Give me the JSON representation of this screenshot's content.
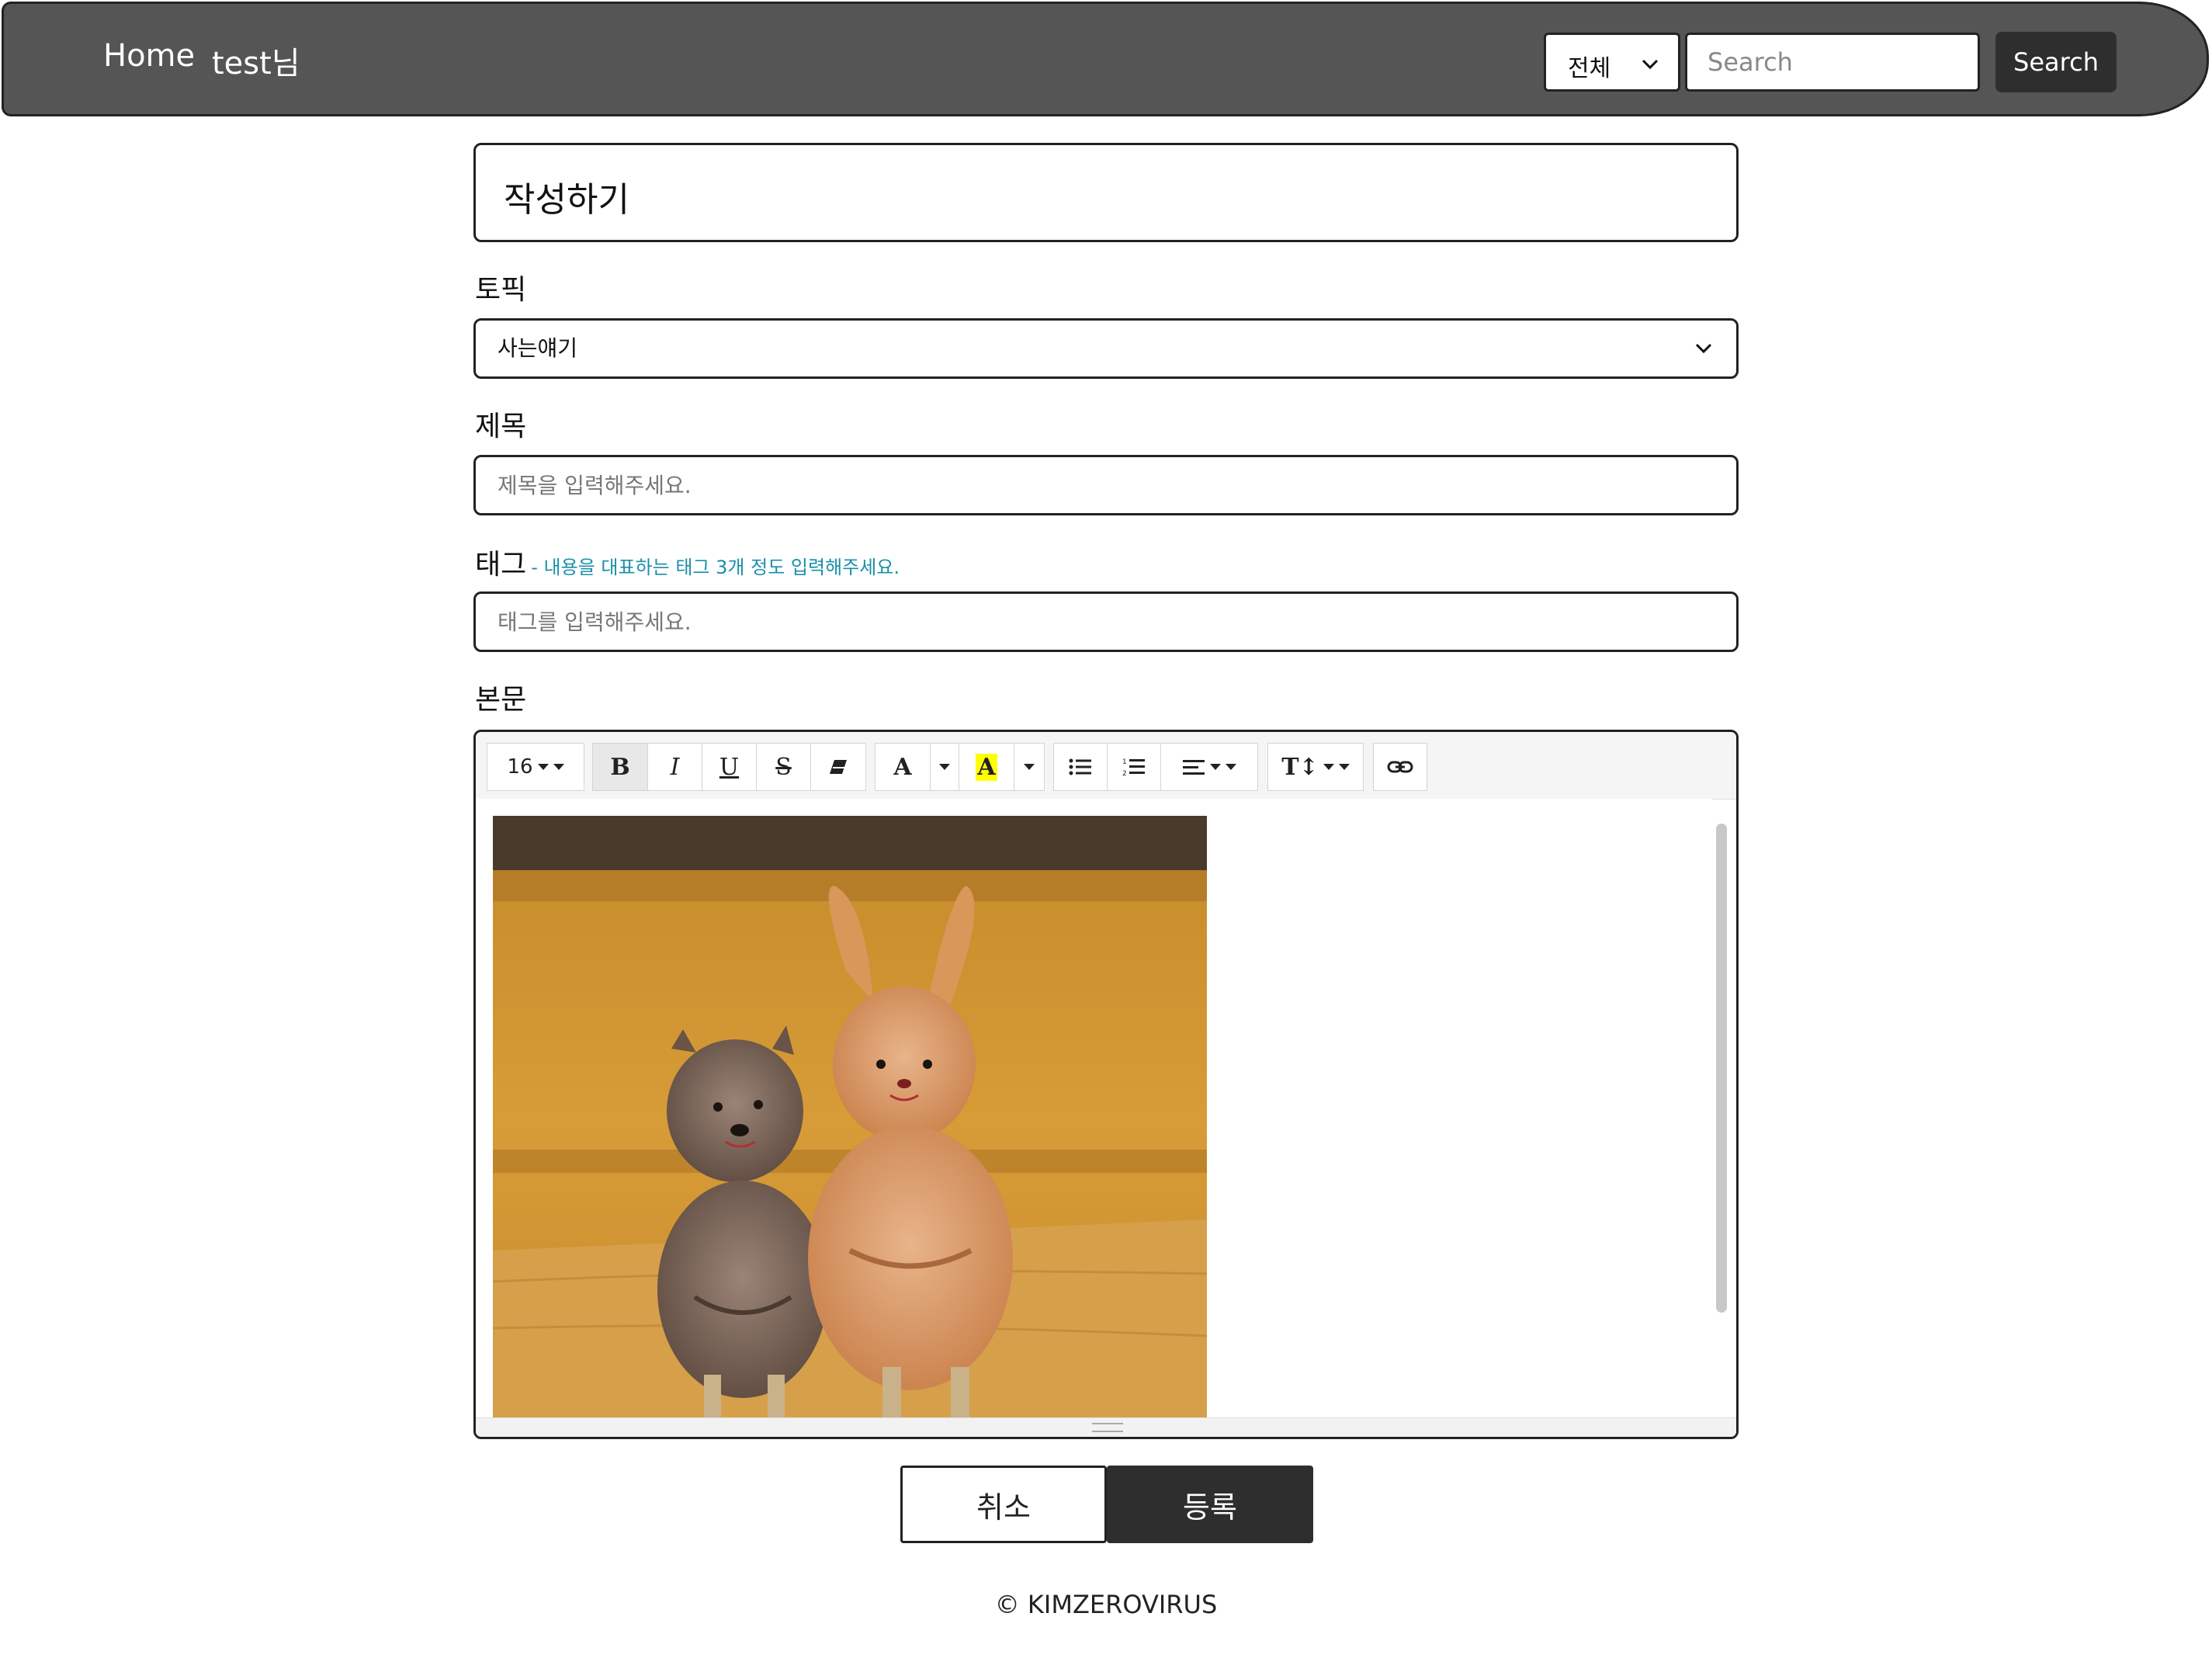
{
  "nav": {
    "home": "Home",
    "user": "test님",
    "search_scope": "전체",
    "search_placeholder": "Search",
    "search_button": "Search"
  },
  "page": {
    "heading": "작성하기"
  },
  "form": {
    "topic_label": "토픽",
    "topic_value": "사는얘기",
    "title_label": "제목",
    "title_placeholder": "제목을 입력해주세요.",
    "tag_label": "태그",
    "tag_hint": "- 내용을 대표하는 태그 3개 정도 입력해주세요.",
    "tag_placeholder": "태그를 입력해주세요.",
    "body_label": "본문"
  },
  "editor": {
    "font_size": "16",
    "bold": "B",
    "italic": "I",
    "underline": "U",
    "strike": "S",
    "fore_color": "A",
    "back_color": "A",
    "height_label": "T↕",
    "icons": [
      "caret-icon",
      "eraser-icon",
      "unordered-list-icon",
      "ordered-list-icon",
      "align-icon",
      "link-icon"
    ],
    "image_content": "photo of two figurines, a squirrel and a rabbit, sitting on a wooden ledge"
  },
  "actions": {
    "cancel": "취소",
    "submit": "등록"
  },
  "footer": {
    "copyright": "© KIMZEROVIRUS"
  },
  "colors": {
    "navbar": "#555555",
    "dark_button": "#2e2e2e",
    "hint": "#1a8fa8",
    "highlight": "#ffff00"
  }
}
